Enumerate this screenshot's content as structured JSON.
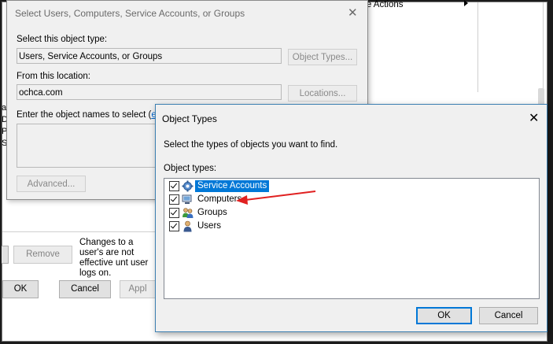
{
  "background_window": {
    "actions_text": "re Actions",
    "left_letters": [
      "al",
      "D",
      "P",
      "S"
    ],
    "remove_button": "Remove",
    "note_text": "Changes to a user's are not effective unt user logs on.",
    "ok_button": "OK",
    "cancel_button": "Cancel",
    "apply_button": "Appl"
  },
  "select_users_dialog": {
    "title": "Select Users, Computers, Service Accounts, or Groups",
    "object_type_label": "Select this object type:",
    "object_type_value": "Users, Service Accounts, or Groups",
    "object_types_button": "Object Types...",
    "location_label": "From this location:",
    "location_value": "ochca.com",
    "locations_button": "Locations...",
    "names_label": "Enter the object names to select (",
    "names_link": "exa",
    "advanced_button": "Advanced..."
  },
  "object_types_dialog": {
    "title": "Object Types",
    "instruction": "Select the types of objects you want to find.",
    "list_label": "Object types:",
    "items": [
      {
        "label": "Service Accounts",
        "checked": true,
        "selected": true,
        "icon": "service-accounts-icon"
      },
      {
        "label": "Computers",
        "checked": true,
        "selected": false,
        "icon": "computer-icon"
      },
      {
        "label": "Groups",
        "checked": true,
        "selected": false,
        "icon": "groups-icon"
      },
      {
        "label": "Users",
        "checked": true,
        "selected": false,
        "icon": "user-icon"
      }
    ],
    "ok_button": "OK",
    "cancel_button": "Cancel"
  },
  "annotation": {
    "color": "#e02020",
    "points_to": "Computers"
  },
  "colors": {
    "selection": "#0078d7",
    "link": "#0066cc",
    "dialog_bg": "#f0f0f0"
  }
}
